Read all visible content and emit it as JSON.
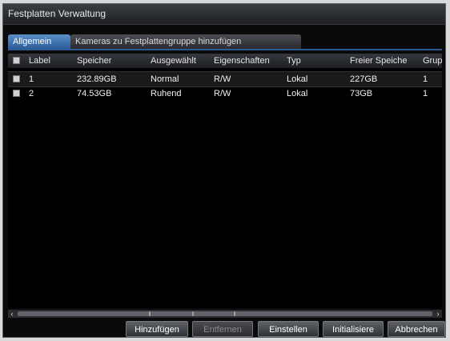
{
  "window": {
    "title": "Festplatten Verwaltung"
  },
  "tabs": [
    {
      "label": "Allgemein",
      "active": true
    },
    {
      "label": "Kameras zu Festplattengruppe hinzufügen",
      "active": false
    }
  ],
  "table": {
    "headers": {
      "label": "Label",
      "speicher": "Speicher",
      "ausgewaehlt": "Ausgewählt",
      "eigenschaften": "Eigenschaften",
      "typ": "Typ",
      "freier_speicher": "Freier Speiche",
      "gruppe": "Grup"
    },
    "rows": [
      {
        "label": "1",
        "speicher": "232.89GB",
        "ausgewaehlt": "Normal",
        "eigenschaften": "R/W",
        "typ": "Lokal",
        "freier_speicher": "227GB",
        "gruppe": "1",
        "selected": true
      },
      {
        "label": "2",
        "speicher": "74.53GB",
        "ausgewaehlt": "Ruhend",
        "eigenschaften": "R/W",
        "typ": "Lokal",
        "freier_speicher": "73GB",
        "gruppe": "1",
        "selected": false
      }
    ]
  },
  "scrollbar": {
    "left_arrow": "‹",
    "right_arrow": "›"
  },
  "buttons": {
    "hinzufuegen": "Hinzufügen",
    "entfernen": "Entfernen",
    "einstellen": "Einstellen",
    "initialisiere": "Initialisiere",
    "abbrechen": "Abbrechen"
  }
}
